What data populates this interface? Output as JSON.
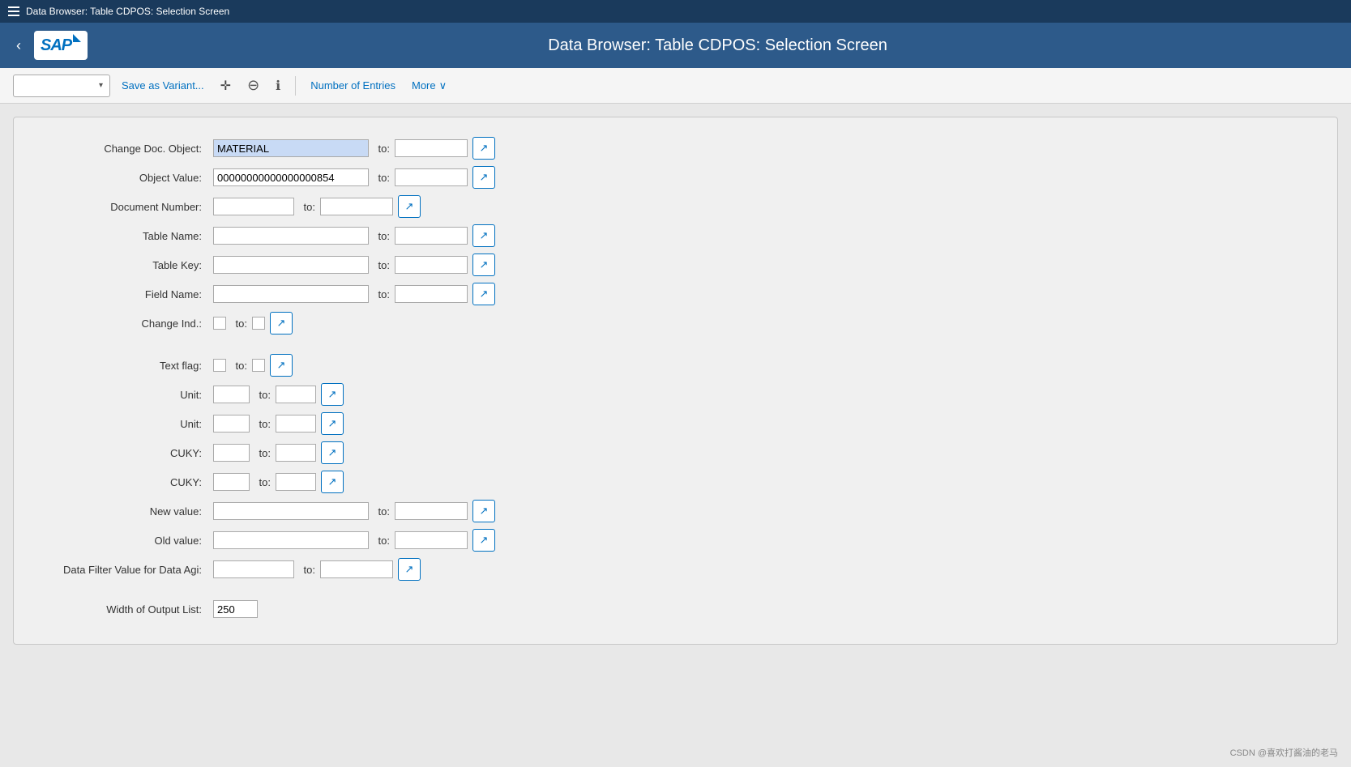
{
  "titleBar": {
    "title": "Data Browser: Table CDPOS: Selection Screen"
  },
  "header": {
    "title": "Data Browser: Table CDPOS: Selection Screen",
    "backLabel": "‹"
  },
  "toolbar": {
    "dropdownPlaceholder": "",
    "saveVariantLabel": "Save as Variant...",
    "moveIcon": "⊕",
    "circleMinusIcon": "⊖",
    "infoIcon": "ℹ",
    "numberOfEntriesLabel": "Number of Entries",
    "moreLabel": "More",
    "moreArrow": "∨"
  },
  "form": {
    "fields": [
      {
        "label": "Change Doc. Object:",
        "fromValue": "MATERIAL",
        "fromHighlight": true,
        "fromWidth": "w2",
        "toWidth": "w4",
        "toValue": "",
        "hasNavBtn": true
      },
      {
        "label": "Object Value:",
        "fromValue": "00000000000000000854",
        "fromHighlight": false,
        "fromWidth": "w2",
        "toWidth": "w4",
        "toValue": "",
        "hasNavBtn": true
      },
      {
        "label": "Document Number:",
        "fromValue": "",
        "fromHighlight": false,
        "fromWidth": "w1",
        "toWidth": "w4",
        "toValue": "",
        "hasNavBtn": true
      },
      {
        "label": "Table Name:",
        "fromValue": "",
        "fromHighlight": false,
        "fromWidth": "w2",
        "toWidth": "w4",
        "toValue": "",
        "hasNavBtn": true
      },
      {
        "label": "Table Key:",
        "fromValue": "",
        "fromHighlight": false,
        "fromWidth": "w2",
        "toWidth": "w4",
        "toValue": "",
        "hasNavBtn": true
      },
      {
        "label": "Field Name:",
        "fromValue": "",
        "fromHighlight": false,
        "fromWidth": "w2",
        "toWidth": "w4",
        "toValue": "",
        "hasNavBtn": true
      },
      {
        "label": "Change Ind.:",
        "fromValue": "",
        "fromHighlight": false,
        "fromWidth": "checkbox",
        "toWidth": "checkbox",
        "toValue": "",
        "hasNavBtn": true
      }
    ],
    "fields2": [
      {
        "label": "Text flag:",
        "fromWidth": "checkbox",
        "toWidth": "checkbox",
        "hasNavBtn": true
      },
      {
        "label": "Unit:",
        "fromWidth": "w5",
        "toWidth": "w6",
        "hasNavBtn": true
      },
      {
        "label": "Unit:",
        "fromWidth": "w5",
        "toWidth": "w6",
        "hasNavBtn": true
      },
      {
        "label": "CUKY:",
        "fromWidth": "w5",
        "toWidth": "w6",
        "hasNavBtn": true
      },
      {
        "label": "CUKY:",
        "fromWidth": "w5",
        "toWidth": "w6",
        "hasNavBtn": true
      },
      {
        "label": "New value:",
        "fromWidth": "w2",
        "toWidth": "w4",
        "hasNavBtn": true
      },
      {
        "label": "Old value:",
        "fromWidth": "w2",
        "toWidth": "w4",
        "hasNavBtn": true
      },
      {
        "label": "Data Filter Value for Data Agi:",
        "fromWidth": "w1",
        "toWidth": "w4",
        "hasNavBtn": true
      }
    ],
    "outputList": {
      "label": "Width of Output List:",
      "value": "250"
    }
  },
  "footer": {
    "note": "CSDN @喜欢打酱油的老马"
  }
}
